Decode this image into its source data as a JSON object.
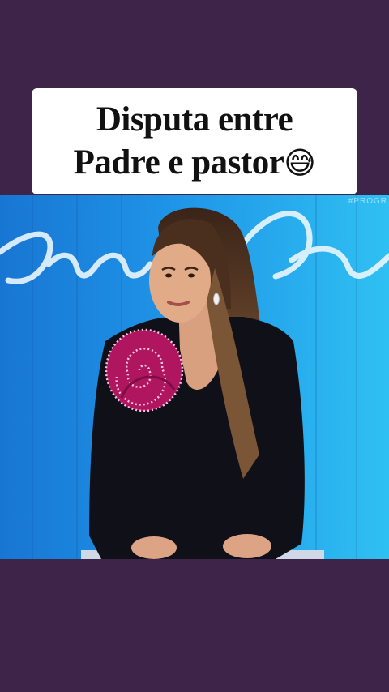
{
  "caption": {
    "line1": "Disputa entre",
    "line2": "Padre e pastor",
    "emoji": "😅"
  },
  "video": {
    "watermark": "#PROGR",
    "scene": "presenter-on-studio-set"
  },
  "colors": {
    "background": "#3f2449",
    "caption_bg": "#ffffff",
    "studio_blue": "#1e8fe6",
    "blazer": "#0f0f17",
    "flower": "#b0155f"
  }
}
